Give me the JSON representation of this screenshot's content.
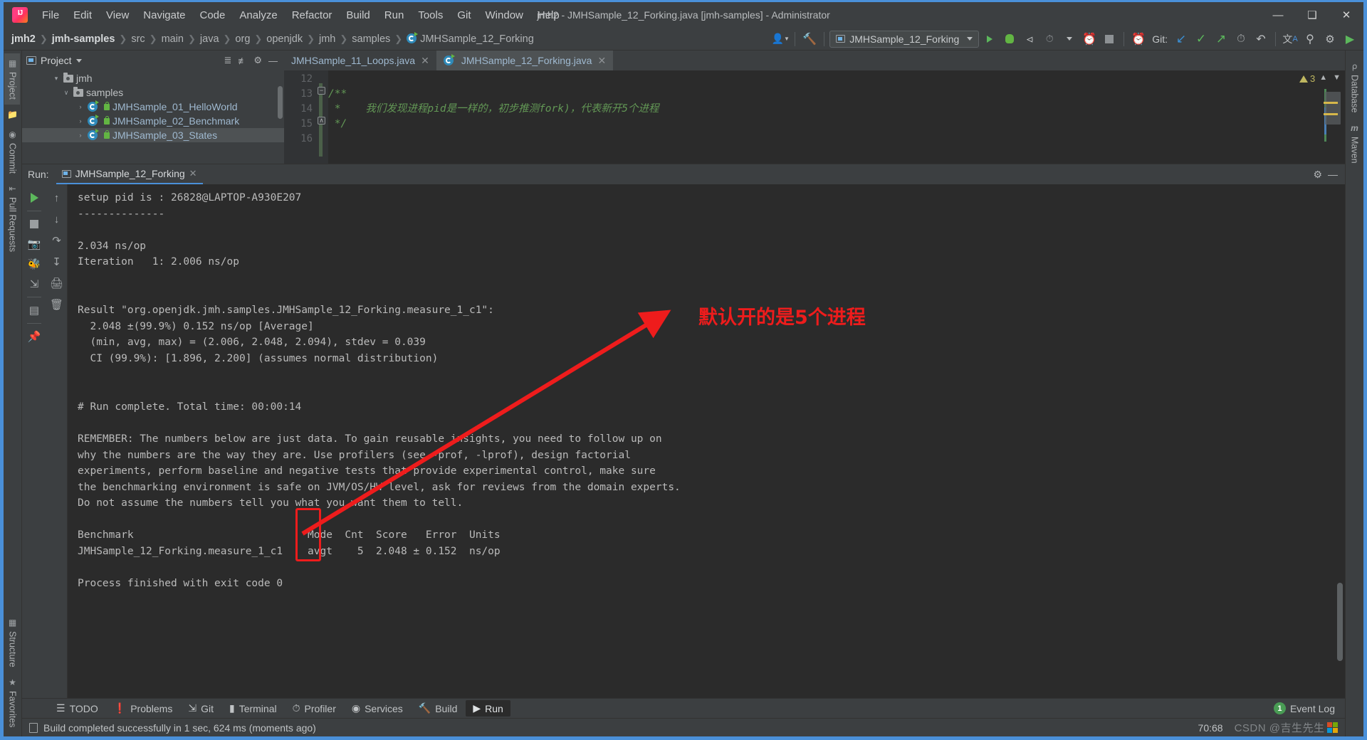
{
  "window": {
    "title": "jmh2 - JMHSample_12_Forking.java [jmh-samples] - Administrator",
    "minimize": "—",
    "maximize": "❑",
    "close": "✕"
  },
  "menu": [
    "File",
    "Edit",
    "View",
    "Navigate",
    "Code",
    "Analyze",
    "Refactor",
    "Build",
    "Run",
    "Tools",
    "Git",
    "Window",
    "Help"
  ],
  "breadcrumbs": [
    "jmh2",
    "jmh-samples",
    "src",
    "main",
    "java",
    "org",
    "openjdk",
    "jmh",
    "samples",
    "JMHSample_12_Forking"
  ],
  "toolbar": {
    "run_config": "JMHSample_12_Forking",
    "git_label": "Git:",
    "icons": [
      "person-icon",
      "build-hammer-icon",
      "run-icon",
      "debug-icon",
      "run-with-coverage-icon",
      "profiler-dropdown-icon",
      "run-dashboard-icon",
      "stop-icon",
      "updates-icon",
      "git-update-icon",
      "git-commit-icon",
      "git-push-icon",
      "git-history-icon",
      "git-rollback-icon",
      "translate-icon",
      "search-icon",
      "settings-icon",
      "ide-features-icon"
    ]
  },
  "left_rail": {
    "top": [
      {
        "label": "Project",
        "icon": "project-icon",
        "active": true
      },
      {
        "label": "",
        "icon": "folder-icon",
        "active": false
      },
      {
        "label": "Commit",
        "icon": "commit-icon",
        "active": false
      },
      {
        "label": "Pull Requests",
        "icon": "pull-requests-icon",
        "active": false
      }
    ],
    "bottom": [
      {
        "label": "Structure",
        "icon": "structure-icon"
      },
      {
        "label": "Favorites",
        "icon": "star-icon"
      }
    ]
  },
  "right_rail": [
    {
      "label": "Database",
      "icon": "database-icon"
    },
    {
      "label": "Maven",
      "icon": "maven-icon"
    }
  ],
  "project_panel": {
    "title": "Project",
    "actions": [
      "expand-all-icon",
      "collapse-all-icon",
      "settings-icon",
      "hide-icon"
    ],
    "tree": [
      {
        "indent": 1,
        "arrow": "▾",
        "icon": "folder",
        "label": "jmh",
        "kind": "folder",
        "selected": false
      },
      {
        "indent": 2,
        "arrow": "∨",
        "icon": "folder",
        "label": "samples",
        "kind": "folder",
        "selected": false
      },
      {
        "indent": 3,
        "arrow": "›",
        "icon": "class",
        "label": "JMHSample_01_HelloWorld",
        "kind": "java",
        "selected": false
      },
      {
        "indent": 3,
        "arrow": "›",
        "icon": "class",
        "label": "JMHSample_02_Benchmark",
        "kind": "java",
        "selected": false
      },
      {
        "indent": 3,
        "arrow": "›",
        "icon": "class",
        "label": "JMHSample_03_States",
        "kind": "java",
        "selected": true
      }
    ]
  },
  "editor": {
    "tabs": [
      {
        "label": "JMHSample_11_Loops.java",
        "active": false,
        "close": "✕"
      },
      {
        "label": "JMHSample_12_Forking.java",
        "active": true,
        "close": "✕"
      }
    ],
    "line_numbers": [
      "12",
      "13",
      "14",
      "15",
      "16"
    ],
    "lines": [
      "",
      "/**",
      " *    我们发现进程pid是一样的，初步推测fork)，代表新开5个进程",
      " */",
      ""
    ],
    "warning_count": "3"
  },
  "run_window": {
    "label": "Run:",
    "tab_title": "JMHSample_12_Forking",
    "tab_close": "✕",
    "header_actions": [
      "settings-icon",
      "hide-icon"
    ],
    "side_actions": [
      "rerun-icon",
      "stop-icon",
      "screenshot-icon",
      "debug-attach-icon",
      "export-icon",
      "layout-icon",
      "pin-icon"
    ],
    "side_actions2": [
      "scroll-up-icon",
      "scroll-down-icon",
      "soft-wrap-icon",
      "scroll-to-end-icon",
      "print-icon",
      "clear-all-icon"
    ],
    "console": "setup pid is : 26828@LAPTOP-A930E207\n--------------\n\n2.034 ns/op\nIteration   1: 2.006 ns/op\n\n\nResult \"org.openjdk.jmh.samples.JMHSample_12_Forking.measure_1_c1\":\n  2.048 ±(99.9%) 0.152 ns/op [Average]\n  (min, avg, max) = (2.006, 2.048, 2.094), stdev = 0.039\n  CI (99.9%): [1.896, 2.200] (assumes normal distribution)\n\n\n# Run complete. Total time: 00:00:14\n\nREMEMBER: The numbers below are just data. To gain reusable insights, you need to follow up on\nwhy the numbers are the way they are. Use profilers (see -prof, -lprof), design factorial\nexperiments, perform baseline and negative tests that provide experimental control, make sure\nthe benchmarking environment is safe on JVM/OS/HW level, ask for reviews from the domain experts.\nDo not assume the numbers tell you what you want them to tell.\n\nBenchmark                            Mode  Cnt  Score   Error  Units\nJMHSample_12_Forking.measure_1_c1    avgt    5  2.048 ± 0.152  ns/op\n\nProcess finished with exit code 0"
  },
  "annotation": {
    "text": "默认开的是5个进程",
    "color": "#ee1c1c"
  },
  "tool_strip": {
    "items": [
      {
        "label": "TODO",
        "icon": "todo-icon",
        "active": false
      },
      {
        "label": "Problems",
        "icon": "problems-icon",
        "active": false
      },
      {
        "label": "Git",
        "icon": "git-icon",
        "active": false
      },
      {
        "label": "Terminal",
        "icon": "terminal-icon",
        "active": false
      },
      {
        "label": "Profiler",
        "icon": "profiler-icon",
        "active": false
      },
      {
        "label": "Services",
        "icon": "services-icon",
        "active": false
      },
      {
        "label": "Build",
        "icon": "build-icon",
        "active": false
      },
      {
        "label": "Run",
        "icon": "run-icon",
        "active": true
      }
    ],
    "event_log": "Event Log",
    "event_log_count": "1"
  },
  "status_bar": {
    "message": "Build completed successfully in 1 sec, 624 ms (moments ago)",
    "caret_position": "70:68",
    "watermark": "CSDN @吉生先生"
  }
}
